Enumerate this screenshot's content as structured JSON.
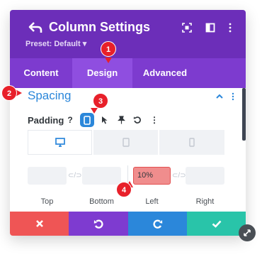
{
  "header": {
    "title": "Column Settings",
    "preset": "Preset: Default ▾",
    "icons": [
      "back-arrow-icon",
      "expand-icon",
      "sidebar-icon",
      "kebab-menu-icon"
    ]
  },
  "tabs": [
    {
      "label": "Content"
    },
    {
      "label": "Design"
    },
    {
      "label": "Advanced"
    }
  ],
  "section": {
    "title": "Spacing",
    "padding_label": "Padding",
    "tools": [
      "?",
      "⋮"
    ]
  },
  "fields": [
    {
      "label": "Top",
      "value": ""
    },
    {
      "label": "Bottom",
      "value": ""
    },
    {
      "label": "Left",
      "value": "10%"
    },
    {
      "label": "Right",
      "value": ""
    }
  ],
  "callouts": [
    "1",
    "2",
    "3",
    "4"
  ],
  "colors": {
    "header": "#6c2eb9",
    "tabs": "#7d3bcf",
    "accent": "#2b87da",
    "cancel": "#ef5555",
    "undo": "#7e3bd0",
    "redo": "#2b87da",
    "save": "#29c4a9",
    "callout": "#e8202a"
  }
}
